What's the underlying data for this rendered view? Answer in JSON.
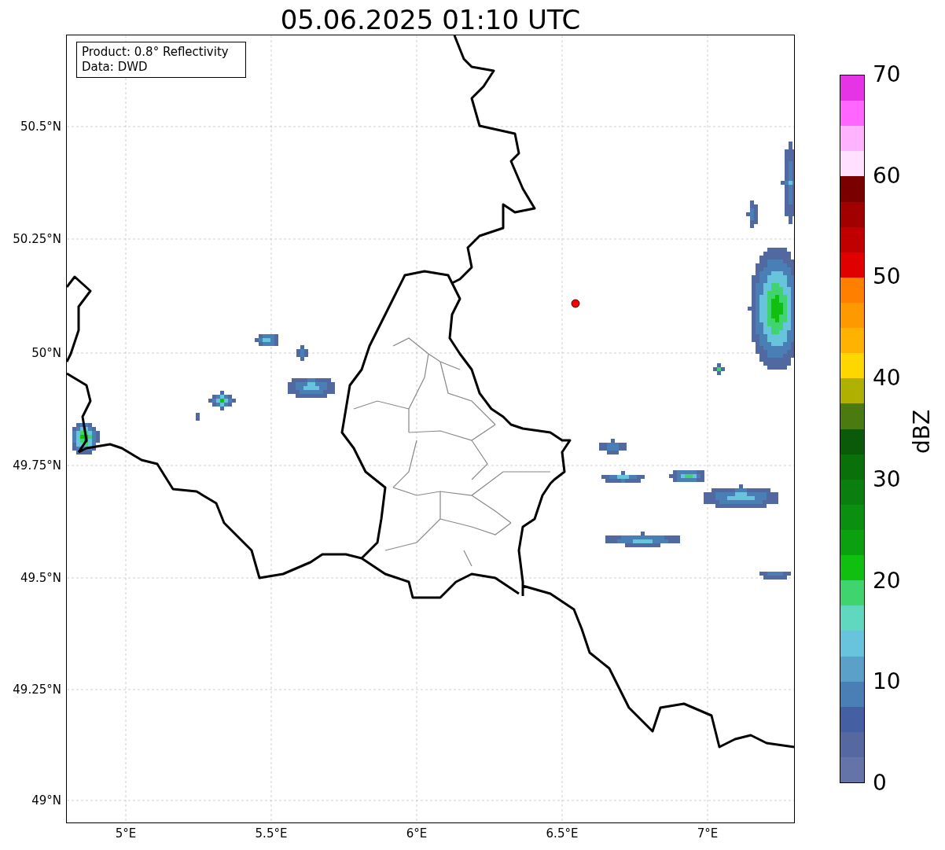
{
  "title": "05.06.2025 01:10 UTC",
  "map": {
    "info_lines": [
      "Product: 0.8° Reflectivity",
      "Data: DWD"
    ],
    "yticks": [
      "50.5°N",
      "50.25°N",
      "50°N",
      "49.75°N",
      "49.5°N",
      "49.25°N",
      "49°N"
    ],
    "xticks": [
      "5°E",
      "5.5°E",
      "6°E",
      "6.5°E",
      "7°E"
    ]
  },
  "colorbar": {
    "label": "dBZ",
    "ticks": [
      "70",
      "60",
      "50",
      "40",
      "30",
      "20",
      "10",
      "0"
    ],
    "segments": [
      {
        "color": "#e633e6"
      },
      {
        "color": "#ff66ff"
      },
      {
        "color": "#ffb3ff"
      },
      {
        "color": "#ffe0ff"
      },
      {
        "color": "#7a0000"
      },
      {
        "color": "#a00000"
      },
      {
        "color": "#c00000"
      },
      {
        "color": "#e00000"
      },
      {
        "color": "#ff8000"
      },
      {
        "color": "#ff9900"
      },
      {
        "color": "#ffb300"
      },
      {
        "color": "#ffd700"
      },
      {
        "color": "#b0b000"
      },
      {
        "color": "#4a7a10"
      },
      {
        "color": "#0a5a0a"
      },
      {
        "color": "#0a700a"
      },
      {
        "color": "#0a7f10"
      },
      {
        "color": "#0a8f10"
      },
      {
        "color": "#0aa010"
      },
      {
        "color": "#10c010"
      },
      {
        "color": "#3fd46e"
      },
      {
        "color": "#60d8c0"
      },
      {
        "color": "#68c4dc"
      },
      {
        "color": "#5aa0c8"
      },
      {
        "color": "#4a7fb5"
      },
      {
        "color": "#4460a3"
      },
      {
        "color": "#5568a0"
      },
      {
        "color": "#6574a8"
      }
    ]
  }
}
